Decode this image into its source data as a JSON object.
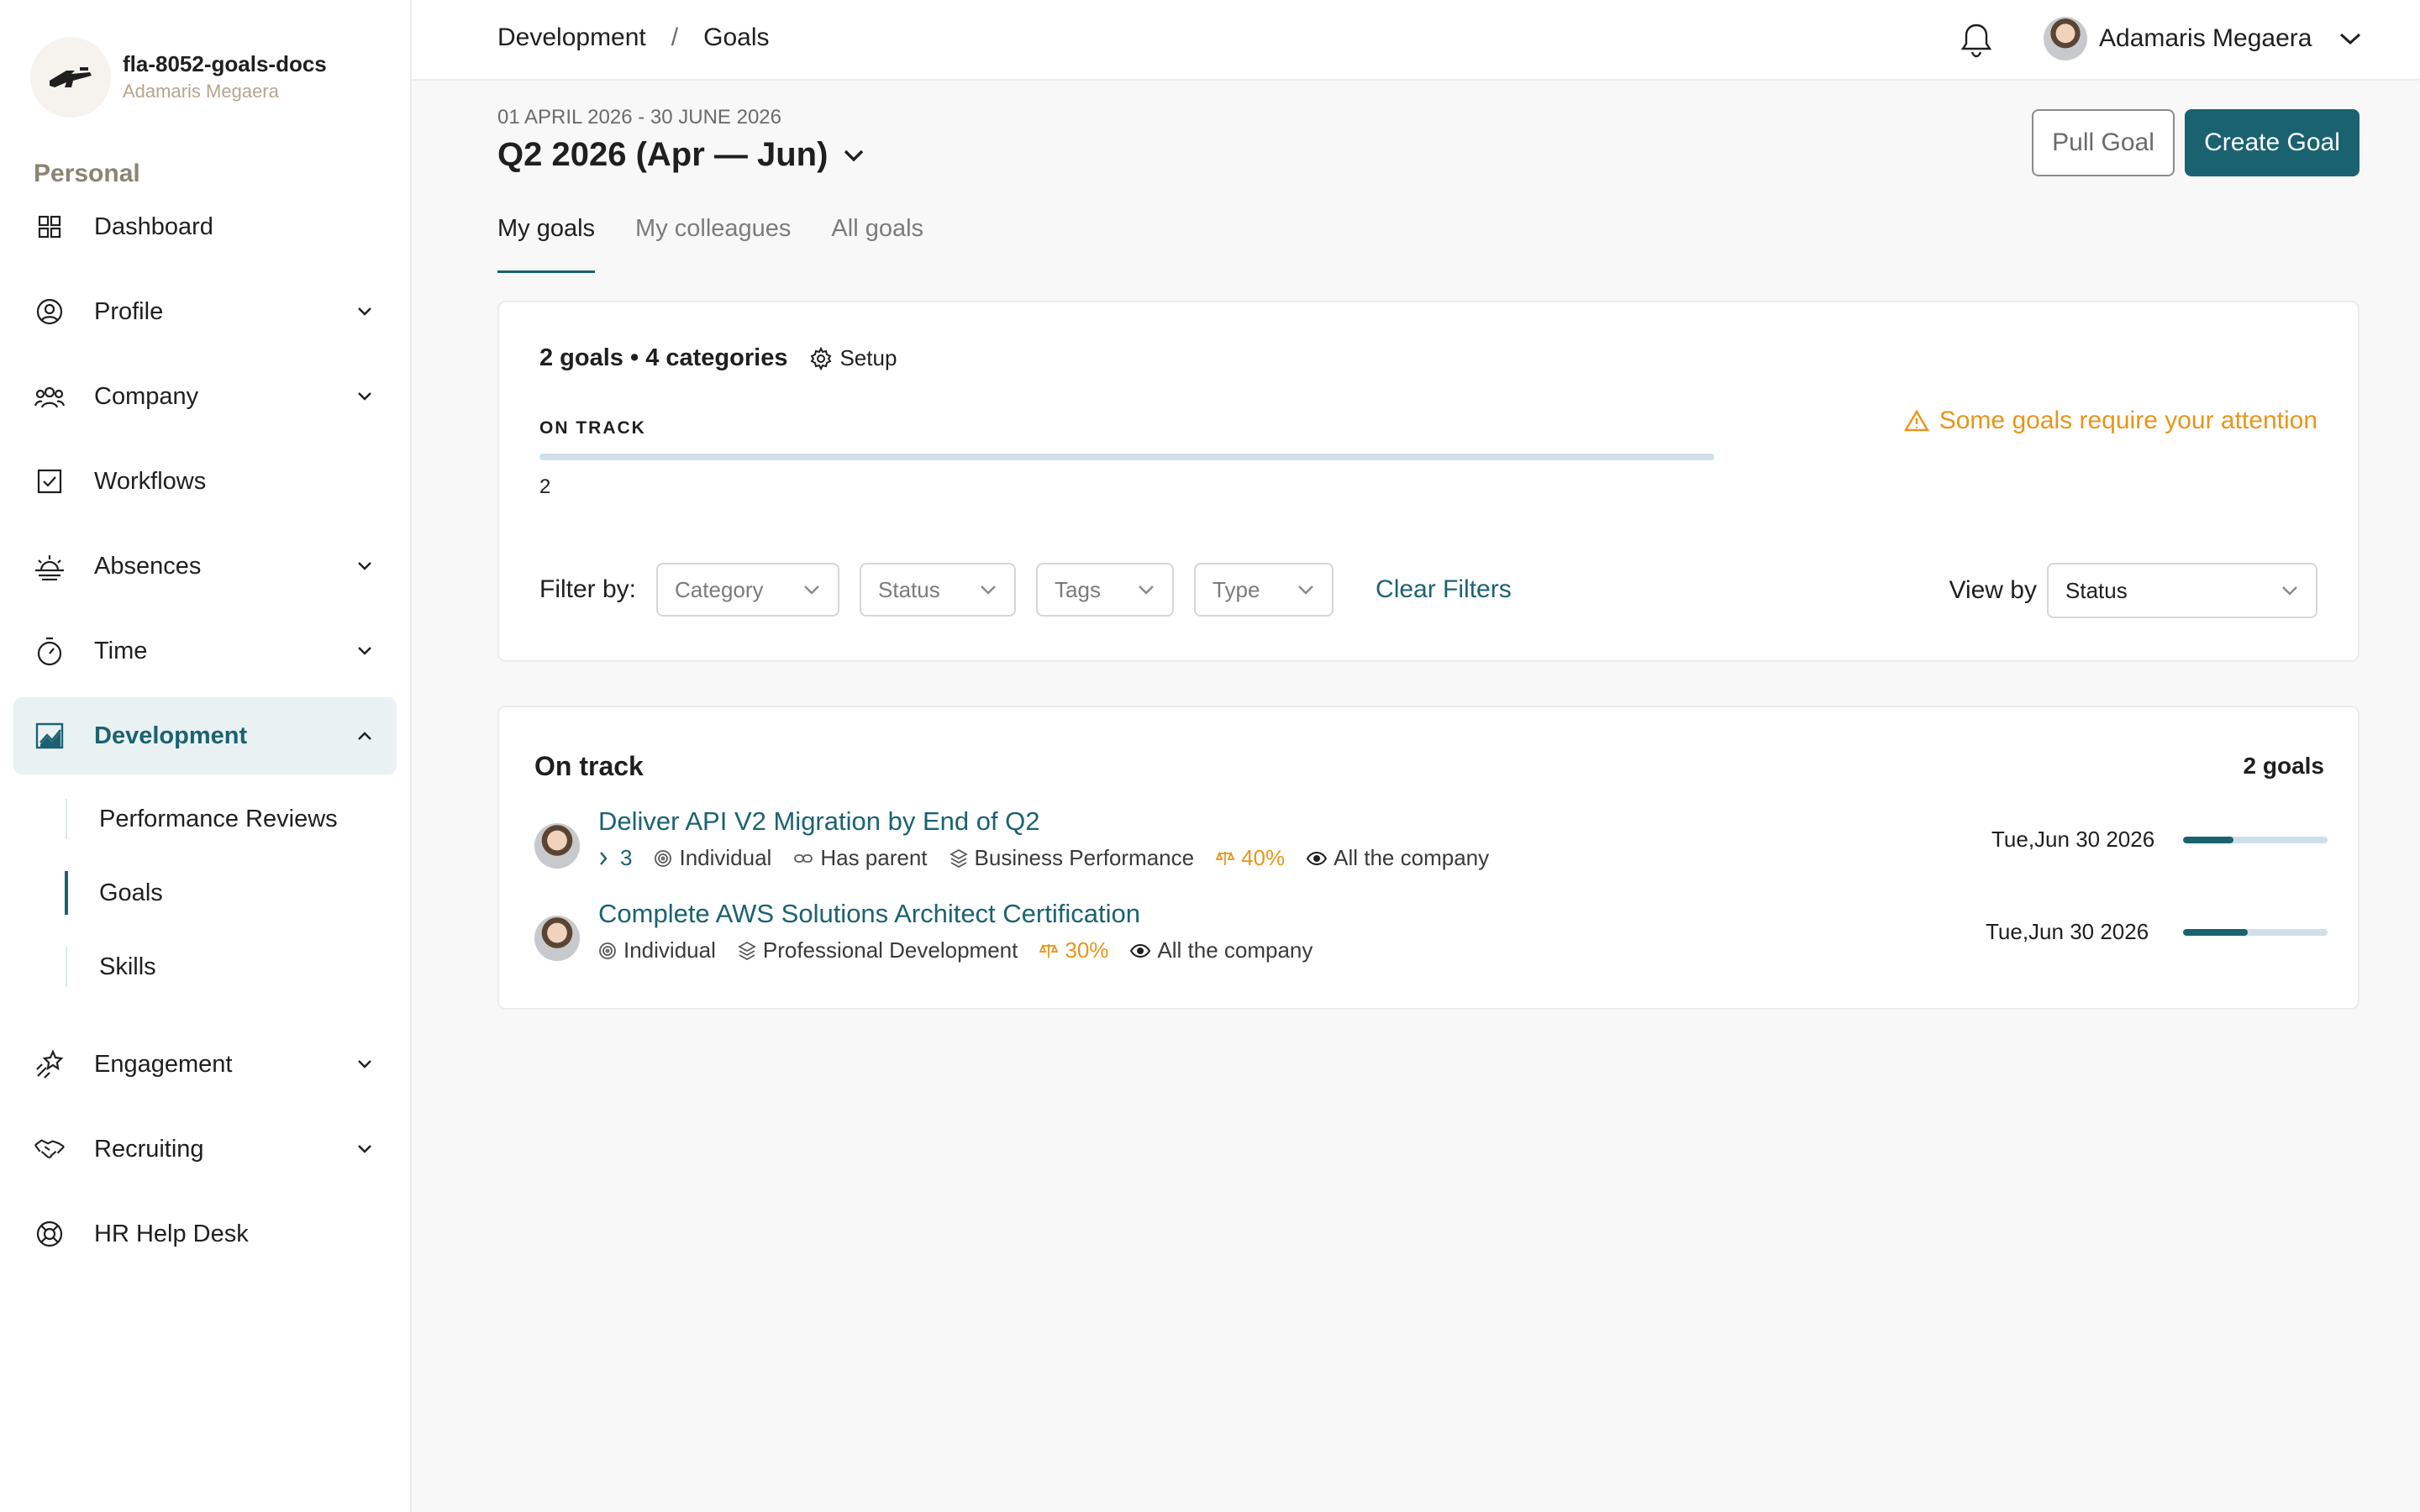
{
  "org": {
    "name": "fla-8052-goals-docs",
    "user": "Adamaris Megaera"
  },
  "sidebar": {
    "section_title": "Personal",
    "items": [
      {
        "label": "Dashboard",
        "icon": "grid-icon"
      },
      {
        "label": "Profile",
        "icon": "user-circle-icon"
      },
      {
        "label": "Company",
        "icon": "people-icon"
      },
      {
        "label": "Workflows",
        "icon": "checkbox-icon"
      },
      {
        "label": "Absences",
        "icon": "sunrise-icon"
      },
      {
        "label": "Time",
        "icon": "stopwatch-icon"
      },
      {
        "label": "Development",
        "icon": "chart-image-icon"
      },
      {
        "label": "Engagement",
        "icon": "sparkle-icon"
      },
      {
        "label": "Recruiting",
        "icon": "handshake-icon"
      },
      {
        "label": "HR Help Desk",
        "icon": "lifebuoy-icon"
      }
    ],
    "sub_items": [
      "Performance Reviews",
      "Goals",
      "Skills"
    ]
  },
  "breadcrumb": {
    "parent": "Development",
    "separator": "/",
    "current": "Goals"
  },
  "header": {
    "user_name": "Adamaris Megaera"
  },
  "page": {
    "date_range": "01 APRIL 2026 - 30 JUNE 2026",
    "period": "Q2 2026 (Apr — Jun)",
    "pull_goal": "Pull Goal",
    "create_goal": "Create Goal",
    "tabs": [
      "My goals",
      "My colleagues",
      "All goals"
    ]
  },
  "summary": {
    "count_text": "2 goals • 4 categories",
    "setup": "Setup",
    "status_label": "ON TRACK",
    "status_count": "2",
    "attention": "Some goals require your attention",
    "filter_label": "Filter by:",
    "filters": [
      "Category",
      "Status",
      "Tags",
      "Type"
    ],
    "clear_filters": "Clear Filters",
    "view_by_label": "View by",
    "view_by_value": "Status"
  },
  "group": {
    "title": "On track",
    "count": "2 goals",
    "goals": [
      {
        "title": "Deliver API V2 Migration by End of Q2",
        "children": "3",
        "type": "Individual",
        "parent": "Has parent",
        "category": "Business Performance",
        "weight": "40%",
        "visibility": "All the company",
        "due": "Tue,Jun 30 2026",
        "progress": 0.35
      },
      {
        "title": "Complete AWS Solutions Architect Certification",
        "type": "Individual",
        "category": "Professional Development",
        "weight": "30%",
        "visibility": "All the company",
        "due": "Tue,Jun 30 2026",
        "progress": 0.45
      }
    ]
  },
  "colors": {
    "accent": "#1b6271",
    "warning": "#e8951a",
    "progress_track": "#cfe0ea"
  }
}
